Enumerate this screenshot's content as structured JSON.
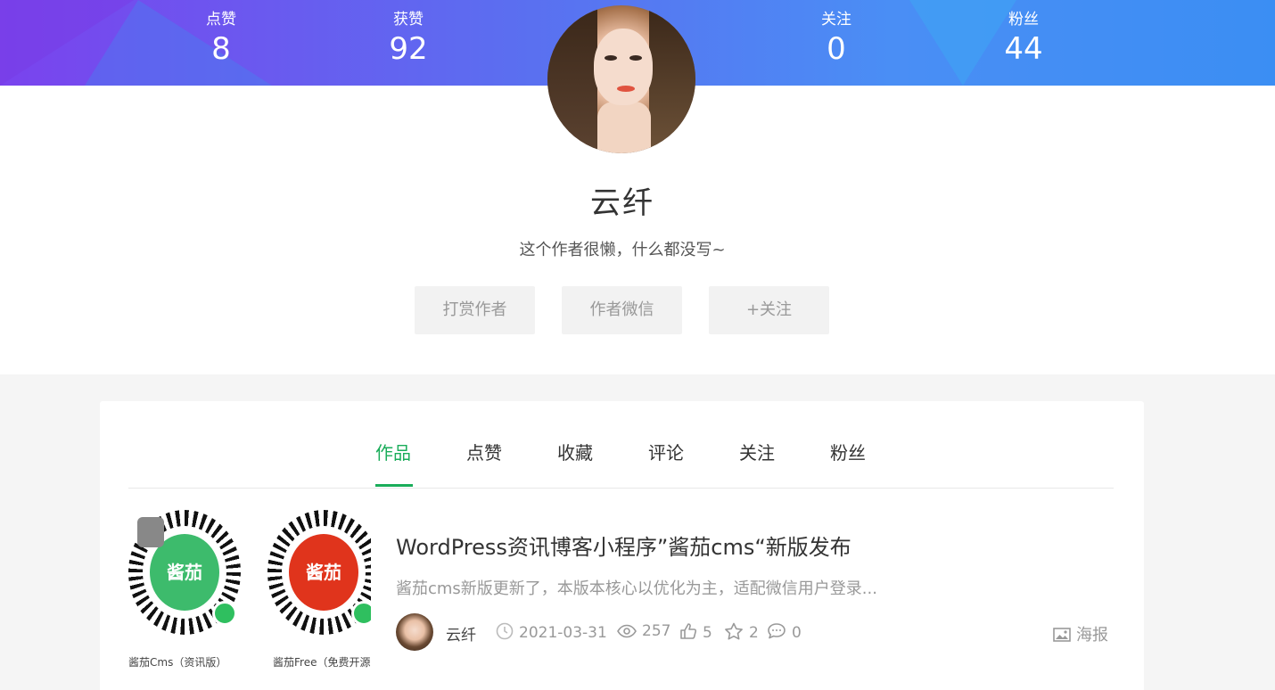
{
  "stats": [
    {
      "label": "点赞",
      "value": "8"
    },
    {
      "label": "获赞",
      "value": "92"
    },
    {
      "label": "关注",
      "value": "0"
    },
    {
      "label": "粉丝",
      "value": "44"
    }
  ],
  "profile": {
    "name": "云纤",
    "description": "这个作者很懒，什么都没写~",
    "buttons": [
      "打赏作者",
      "作者微信",
      "+关注"
    ]
  },
  "tabs": [
    "作品",
    "点赞",
    "收藏",
    "评论",
    "关注",
    "粉丝"
  ],
  "post": {
    "qr_codes": [
      {
        "center_text": "酱茄",
        "caption": "酱茄Cms（资讯版）",
        "color": "#3dbb6c"
      },
      {
        "center_text": "酱茄",
        "caption": "酱茄Free（免费开源",
        "color": "#e0341c"
      }
    ],
    "title": "WordPress资讯博客小程序”酱茄cms“新版发布",
    "excerpt": "酱茄cms新版更新了，本版本核心以优化为主，适配微信用户登录...",
    "author": "云纤",
    "date": "2021-03-31",
    "views": "257",
    "likes": "5",
    "favorites": "2",
    "comments": "0",
    "poster_label": "海报"
  },
  "colors": {
    "accent": "#1aad5a",
    "banner_start": "#7a43ee",
    "banner_end": "#3b8ef3"
  }
}
